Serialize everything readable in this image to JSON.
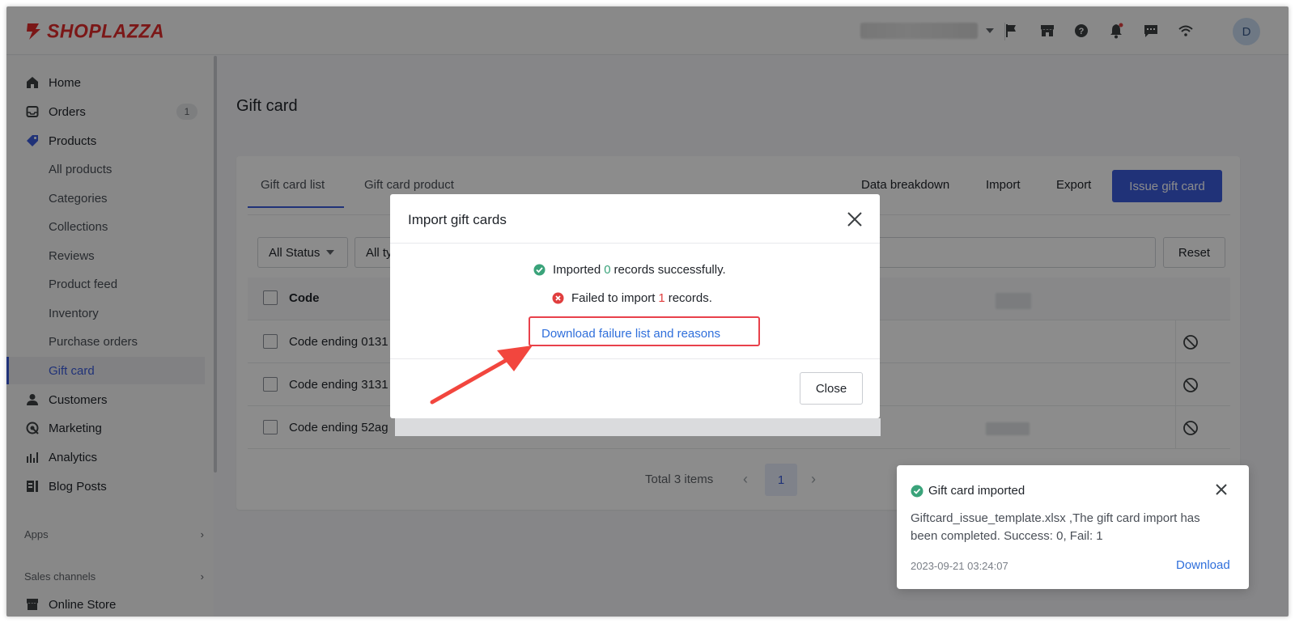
{
  "brand": {
    "name": "SHOPLAZZA",
    "color": "#e02b2b"
  },
  "topbar": {
    "avatar_initial": "D",
    "icons": [
      "flag-icon",
      "store-icon",
      "help-icon",
      "bell-icon",
      "chat-icon",
      "wifi-icon"
    ]
  },
  "sidebar": {
    "items": [
      {
        "label": "Home",
        "icon": "home-icon"
      },
      {
        "label": "Orders",
        "icon": "orders-icon",
        "badge": "1"
      },
      {
        "label": "Products",
        "icon": "tag-icon"
      },
      {
        "label": "All products"
      },
      {
        "label": "Categories"
      },
      {
        "label": "Collections"
      },
      {
        "label": "Reviews"
      },
      {
        "label": "Product feed"
      },
      {
        "label": "Inventory"
      },
      {
        "label": "Purchase orders"
      },
      {
        "label": "Gift card",
        "active": true
      },
      {
        "label": "Customers",
        "icon": "person-icon"
      },
      {
        "label": "Marketing",
        "icon": "marketing-icon"
      },
      {
        "label": "Analytics",
        "icon": "analytics-icon"
      },
      {
        "label": "Blog Posts",
        "icon": "blog-icon"
      }
    ],
    "apps_label": "Apps",
    "sales_channels_label": "Sales channels",
    "online_store_label": "Online Store"
  },
  "page": {
    "title": "Gift card",
    "tabs": [
      "Gift card list",
      "Gift card product"
    ],
    "actions": {
      "data_breakdown": "Data breakdown",
      "import": "Import",
      "export": "Export",
      "issue": "Issue gift card"
    },
    "filters": {
      "status": "All Status",
      "type": "All ty",
      "reset": "Reset"
    },
    "table": {
      "header_code": "Code",
      "rows": [
        "Code ending 0131",
        "Code ending 3131",
        "Code ending 52ag"
      ]
    },
    "pagination": {
      "total": "Total 3 items",
      "current": "1"
    }
  },
  "modal": {
    "title": "Import gift cards",
    "success_prefix": "Imported",
    "success_count": "0",
    "success_suffix": "records successfully.",
    "fail_prefix": "Failed to import",
    "fail_count": "1",
    "fail_suffix": "records.",
    "download_link": "Download failure list and reasons",
    "close_button": "Close"
  },
  "toast": {
    "title": "Gift card imported",
    "body": "Giftcard_issue_template.xlsx ,The gift card import has been completed. Success: 0, Fail: 1",
    "timestamp": "2023-09-21 03:24:07",
    "download": "Download"
  },
  "colors": {
    "accent": "#3b5bdb",
    "success": "#3aa37a",
    "error": "#e03e3e",
    "link": "#2f6fdb",
    "annotation": "#e8414b"
  }
}
